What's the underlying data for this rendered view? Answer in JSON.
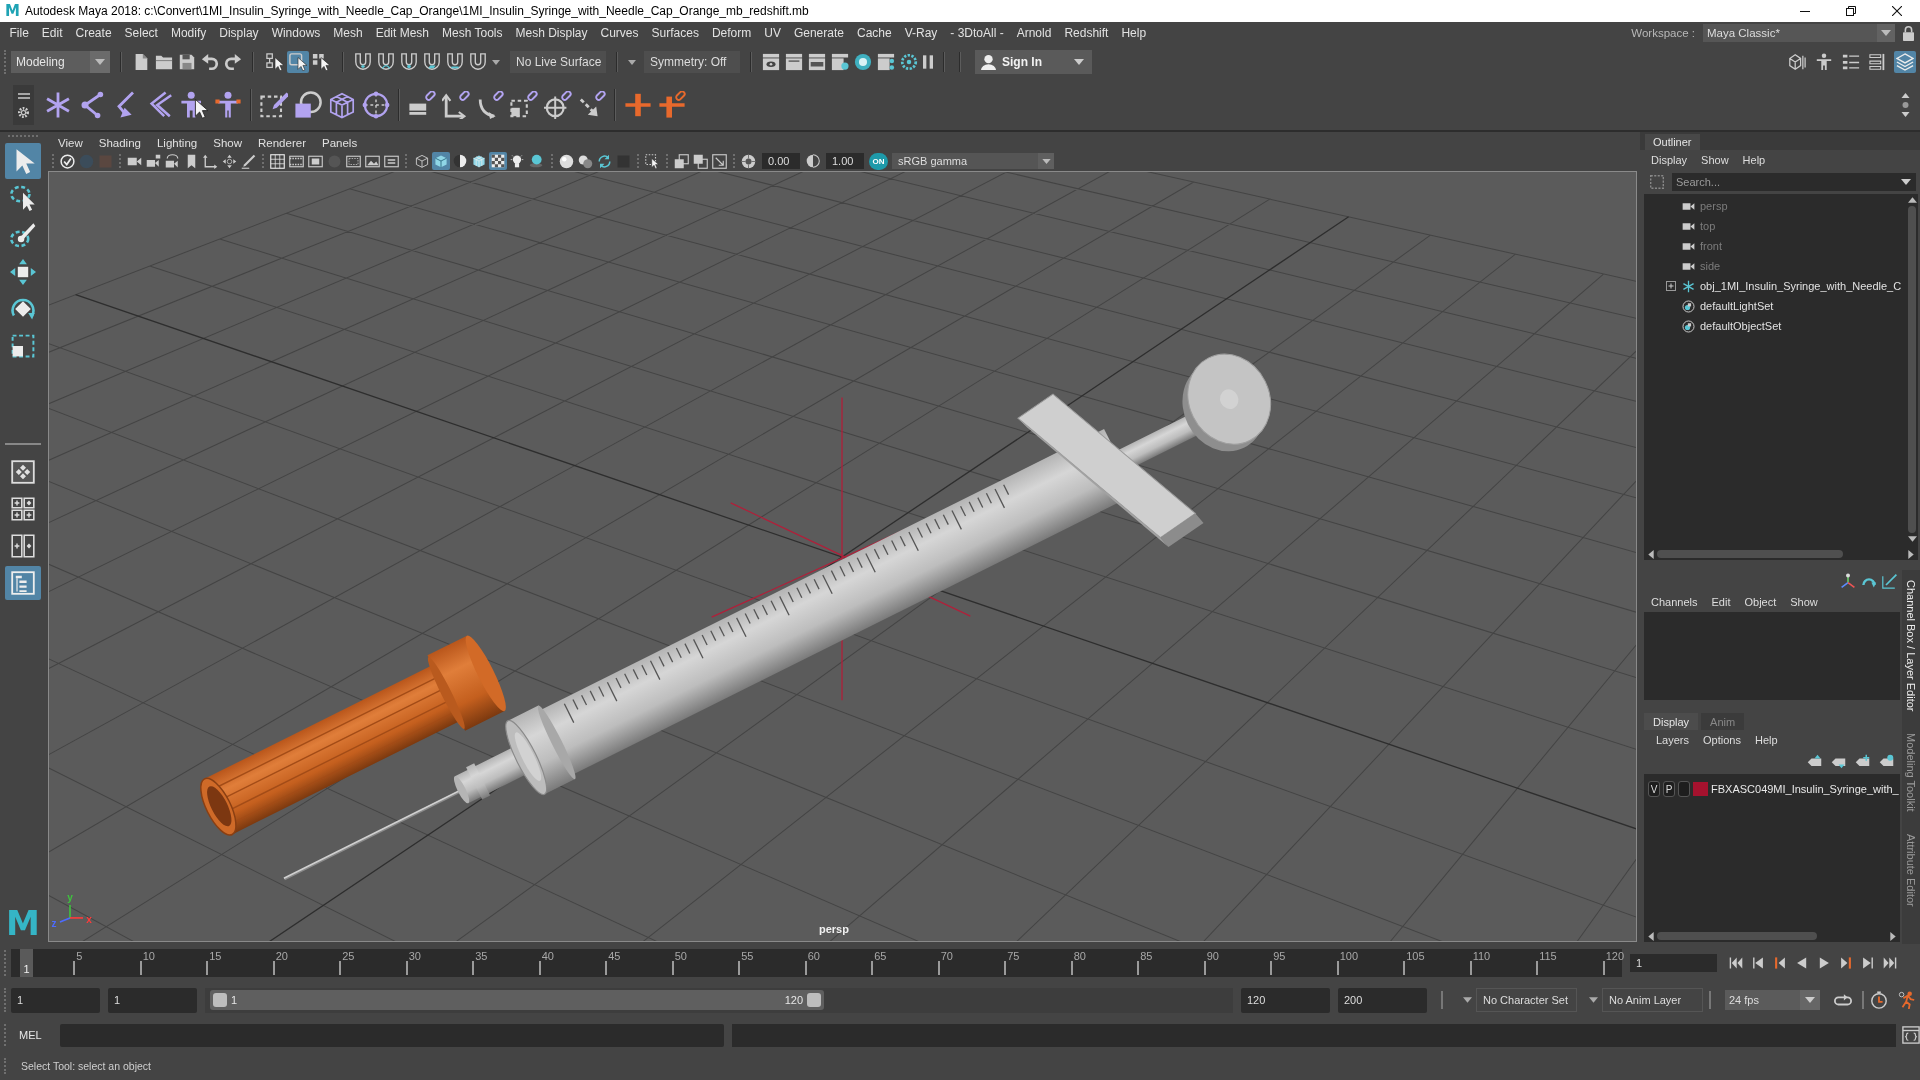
{
  "title_bar": {
    "logo": "M",
    "title": "Autodesk Maya 2018: c:\\Convert\\1MI_Insulin_Syringe_with_Needle_Cap_Orange\\1MI_Insulin_Syringe_with_Needle_Cap_Orange_mb_redshift.mb"
  },
  "menu_bar": {
    "items": [
      "File",
      "Edit",
      "Create",
      "Select",
      "Modify",
      "Display",
      "Windows",
      "Mesh",
      "Edit Mesh",
      "Mesh Tools",
      "Mesh Display",
      "Curves",
      "Surfaces",
      "Deform",
      "UV",
      "Generate",
      "Cache",
      "V-Ray",
      "- 3DtoAll -",
      "Arnold",
      "Redshift",
      "Help"
    ],
    "workspace_label": "Workspace :",
    "workspace": "Maya Classic*"
  },
  "status_line": {
    "menu_set": "Modeling",
    "selection_modes": [
      {
        "selected": false
      },
      {
        "selected": true
      },
      {
        "selected": false
      }
    ],
    "live_surface": "No Live Surface",
    "symmetry": "Symmetry: Off",
    "sign_in": "Sign In",
    "panel_toggles": [
      {
        "on": false
      },
      {
        "on": false
      },
      {
        "on": false
      },
      {
        "on": false
      },
      {
        "on": true
      }
    ]
  },
  "toolbox": {
    "tools": [
      {
        "kind": "select",
        "selected": true
      },
      {
        "kind": "lasso",
        "selected": false
      },
      {
        "kind": "paint",
        "selected": false
      },
      {
        "kind": "move",
        "selected": false
      },
      {
        "kind": "rotate",
        "selected": false
      },
      {
        "kind": "scale",
        "selected": false
      }
    ],
    "layouts": [
      {
        "kind": "single",
        "selected": false
      },
      {
        "kind": "four",
        "selected": false
      },
      {
        "kind": "two",
        "selected": false
      },
      {
        "kind": "outliner",
        "selected": true
      }
    ],
    "logo": "M"
  },
  "viewport": {
    "menu": [
      "View",
      "Shading",
      "Lighting",
      "Show",
      "Renderer",
      "Panels"
    ],
    "shading_buttons": [
      {
        "on": false
      },
      {
        "on": true
      },
      {
        "on": false
      },
      {
        "on": false
      },
      {
        "on": true
      },
      {
        "on": false
      },
      {
        "on": false
      }
    ],
    "exposure": "0.00",
    "gamma": "1.00",
    "color_management": {
      "on": true,
      "label": "ON"
    },
    "view_transform": "sRGB gamma",
    "camera": "persp",
    "axis_labels": [
      "y",
      "z",
      "x"
    ]
  },
  "outliner": {
    "tab": "Outliner",
    "menu": [
      "Display",
      "Show",
      "Help"
    ],
    "search_placeholder": "Search...",
    "items": [
      {
        "kind": "camera",
        "label": "persp",
        "dimmed": true,
        "expandable": false
      },
      {
        "kind": "camera",
        "label": "top",
        "dimmed": true,
        "expandable": false
      },
      {
        "kind": "camera",
        "label": "front",
        "dimmed": true,
        "expandable": false
      },
      {
        "kind": "camera",
        "label": "side",
        "dimmed": true,
        "expandable": false
      },
      {
        "kind": "group",
        "label": "obj_1MI_Insulin_Syringe_with_Needle_C",
        "dimmed": false,
        "expandable": true
      },
      {
        "kind": "set",
        "label": "defaultLightSet",
        "dimmed": false,
        "expandable": false
      },
      {
        "kind": "set",
        "label": "defaultObjectSet",
        "dimmed": false,
        "expandable": false
      }
    ]
  },
  "channel_box": {
    "menu": [
      "Channels",
      "Edit",
      "Object",
      "Show"
    ]
  },
  "layer_editor": {
    "tabs": [
      {
        "label": "Display",
        "selected": true
      },
      {
        "label": "Anim",
        "selected": false
      }
    ],
    "menu": [
      "Layers",
      "Options",
      "Help"
    ],
    "layers": [
      {
        "visibility": "V",
        "playback": "P",
        "color": "#a5122e",
        "name": "FBXASC049MI_Insulin_Syringe_with_"
      }
    ]
  },
  "side_tabs": [
    {
      "label": "Channel Box / Layer Editor",
      "selected": true
    },
    {
      "label": "Modeling Toolkit",
      "selected": false
    },
    {
      "label": "Attribute Editor",
      "selected": false
    }
  ],
  "timeline": {
    "ticks": [
      "5",
      "10",
      "15",
      "20",
      "25",
      "30",
      "35",
      "40",
      "45",
      "50",
      "55",
      "60",
      "65",
      "70",
      "75",
      "80",
      "85",
      "90",
      "95",
      "100",
      "105",
      "110",
      "115",
      "120"
    ],
    "playhead": {
      "label": "1",
      "level": 0
    },
    "current_frame": "1"
  },
  "range": {
    "start": "1",
    "playback_start": "1",
    "slider_start": "1",
    "slider_end": "120",
    "playback_end": "120",
    "end": "200",
    "character_set": "No Character Set",
    "anim_layer": "No Anim Layer",
    "fps": "24 fps"
  },
  "command_line": {
    "language": "MEL"
  },
  "help_line": "Select Tool: select an object"
}
